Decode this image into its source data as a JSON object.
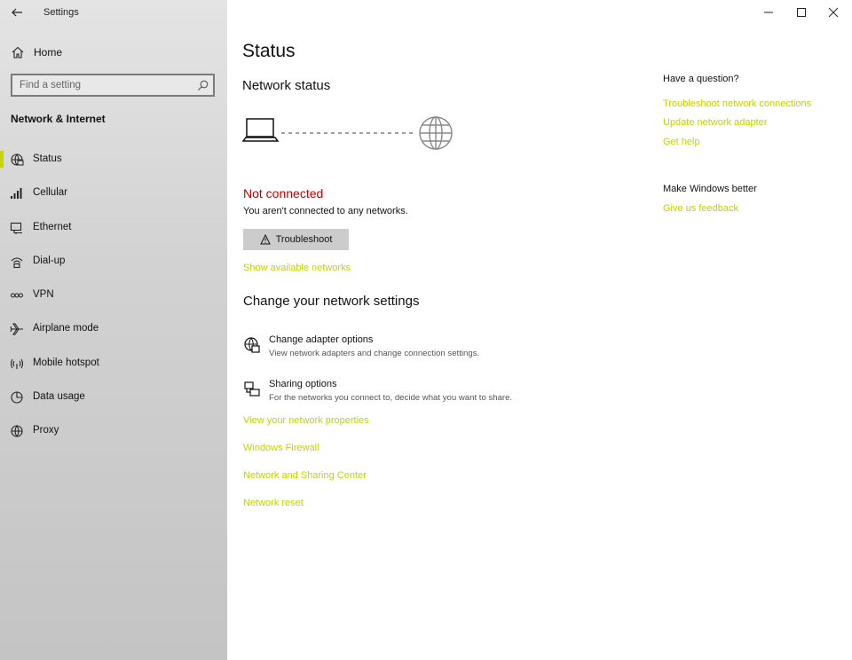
{
  "window": {
    "title": "Settings"
  },
  "sidebar": {
    "home_label": "Home",
    "search_placeholder": "Find a setting",
    "section_title": "Network & Internet",
    "items": [
      {
        "label": "Status",
        "icon": "status-icon",
        "selected": true
      },
      {
        "label": "Cellular",
        "icon": "cellular-icon"
      },
      {
        "label": "Ethernet",
        "icon": "ethernet-icon"
      },
      {
        "label": "Dial-up",
        "icon": "dialup-icon"
      },
      {
        "label": "VPN",
        "icon": "vpn-icon"
      },
      {
        "label": "Airplane mode",
        "icon": "airplane-icon"
      },
      {
        "label": "Mobile hotspot",
        "icon": "hotspot-icon"
      },
      {
        "label": "Data usage",
        "icon": "data-usage-icon"
      },
      {
        "label": "Proxy",
        "icon": "proxy-icon"
      }
    ]
  },
  "main": {
    "page_title": "Status",
    "network_status_title": "Network status",
    "connection_status": "Not connected",
    "connection_desc": "You aren't connected to any networks.",
    "troubleshoot_label": "Troubleshoot",
    "show_networks_link": "Show available networks",
    "change_title": "Change your network settings",
    "options": [
      {
        "title": "Change adapter options",
        "desc": "View network adapters and change connection settings.",
        "icon": "adapter-icon"
      },
      {
        "title": "Sharing options",
        "desc": "For the networks you connect to, decide what you want to share.",
        "icon": "sharing-icon"
      }
    ],
    "links": [
      "View your network properties",
      "Windows Firewall",
      "Network and Sharing Center",
      "Network reset"
    ]
  },
  "help": {
    "question_title": "Have a question?",
    "links": [
      "Troubleshoot network connections",
      "Update network adapter",
      "Get help"
    ],
    "better_title": "Make Windows better",
    "feedback_link": "Give us feedback"
  },
  "colors": {
    "accent": "#c2d200",
    "error": "#c00000",
    "selection": "#c6d400"
  }
}
